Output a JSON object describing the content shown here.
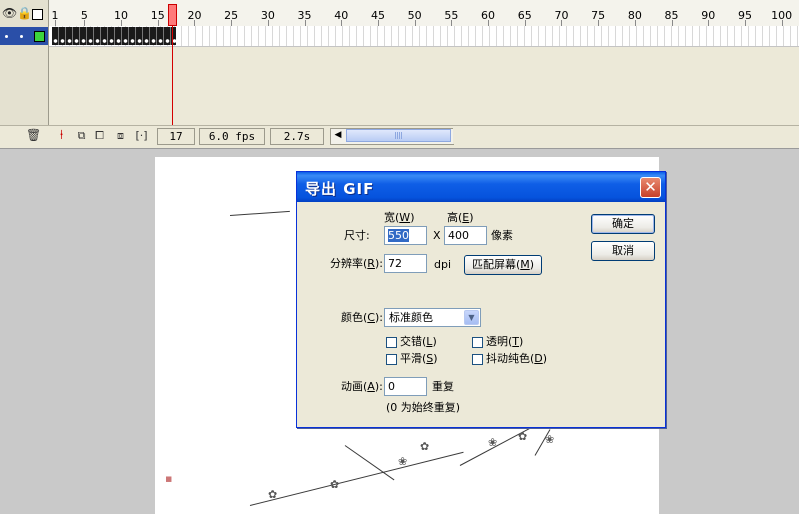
{
  "timeline": {
    "ruler_labels": [
      "1",
      "5",
      "10",
      "15",
      "20",
      "25",
      "30",
      "35",
      "40",
      "45",
      "50",
      "55",
      "60",
      "65",
      "70",
      "75",
      "80",
      "85",
      "90",
      "95",
      "100"
    ],
    "layer": {
      "dot1": "•",
      "dot2": "•"
    },
    "status": {
      "current_frame": "17",
      "frame_rate": "6.0 fps",
      "elapsed_time": "2.7s"
    },
    "icons": {
      "eye": "eye-icon",
      "lock": "lock-icon",
      "outline": "outline-icon",
      "trash": "trash-icon",
      "onion": "onion-skin-icon"
    }
  },
  "dialog": {
    "title": "导出 GIF",
    "close_glyph": "✕",
    "size": {
      "label": "尺寸:",
      "width_header": "宽",
      "width_hotkey": "W",
      "height_header": "高",
      "height_hotkey": "E",
      "width_value": "550",
      "separator": "X",
      "height_value": "400",
      "unit": "像素"
    },
    "resolution": {
      "label": "分辨率",
      "hotkey": "R",
      "value": "72",
      "unit": "dpi",
      "match_button": "匹配屏幕",
      "match_hotkey": "M"
    },
    "colors": {
      "label": "颜色",
      "hotkey": "C",
      "selected": "标准颜色"
    },
    "options": {
      "interlace": "交错",
      "interlace_key": "L",
      "transparent": "透明",
      "transparent_key": "T",
      "smooth": "平滑",
      "smooth_key": "S",
      "dither": "抖动纯色",
      "dither_key": "D"
    },
    "animation": {
      "label": "动画",
      "hotkey": "A",
      "value": "0",
      "unit": "重复",
      "hint": "(0 为始终重复)"
    },
    "buttons": {
      "ok": "确定",
      "cancel": "取消"
    }
  },
  "colors": {
    "title_blue": "#0653dd",
    "close_red": "#c6402a",
    "playhead": "#d40000",
    "selection": "#316ac5"
  }
}
